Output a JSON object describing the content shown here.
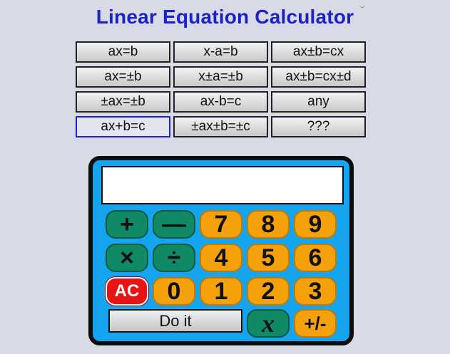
{
  "title": "Linear Equation Calculator",
  "equation_types": [
    {
      "label": "ax=b"
    },
    {
      "label": "x-a=b"
    },
    {
      "label": "ax±b=cx"
    },
    {
      "label": "ax=±b"
    },
    {
      "label": "x±a=±b"
    },
    {
      "label": "ax±b=cx±d"
    },
    {
      "label": "±ax=±b"
    },
    {
      "label": "ax-b=c"
    },
    {
      "label": "any"
    },
    {
      "label": "ax+b=c"
    },
    {
      "label": "±ax±b=±c"
    },
    {
      "label": "???"
    }
  ],
  "selected_type": "ax+b=c",
  "calculator": {
    "display": "",
    "keys": {
      "plus": "+",
      "minus": "—",
      "times": "×",
      "divide": "÷",
      "clear": "AC",
      "n0": "0",
      "n1": "1",
      "n2": "2",
      "n3": "3",
      "n4": "4",
      "n5": "5",
      "n6": "6",
      "n7": "7",
      "n8": "8",
      "n9": "9",
      "x": "x",
      "plus_minus": "+/-"
    },
    "do_it": "Do it"
  },
  "colors": {
    "title": "#1a22c8",
    "calculator_body": "#14a4f0",
    "number_key": "#f5a10c",
    "operator_key": "#0f8a64",
    "clear_key": "#e81414"
  }
}
